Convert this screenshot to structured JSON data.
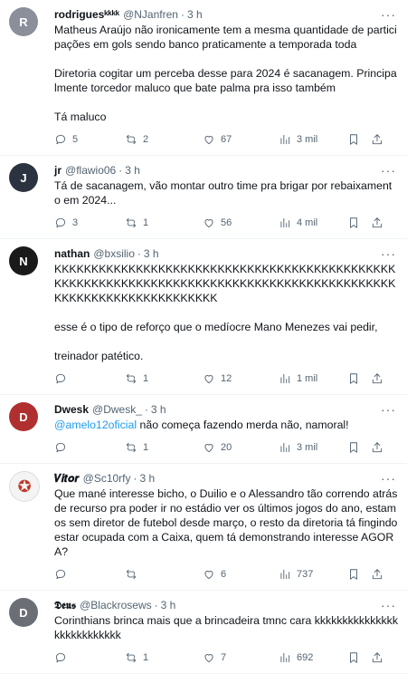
{
  "tweets": [
    {
      "name": "rodriguesᵏᵏᵏᵏ",
      "handle": "@NJanfren",
      "time": "3 h",
      "avatar_color": "#8a8f99",
      "avatar_initial": "R",
      "paragraphs": [
        "Matheus Araújo não ironicamente tem a mesma quantidade de participações em gols sendo banco praticamente a temporada toda",
        "Diretoria cogitar um perceba desse para 2024 é sacanagem. Principalmente torcedor maluco que bate palma pra isso também",
        "Tá maluco"
      ],
      "replies": "5",
      "retweets": "2",
      "likes": "67",
      "views": "3 mil"
    },
    {
      "name": "jr",
      "handle": "@flawio06",
      "time": "3 h",
      "avatar_color": "#2b3340",
      "avatar_initial": "J",
      "paragraphs": [
        "Tá de sacanagem, vão montar outro time pra brigar por rebaixamento em 2024..."
      ],
      "replies": "3",
      "retweets": "1",
      "likes": "56",
      "views": "4 mil"
    },
    {
      "name": "nathan",
      "handle": "@bxsilio",
      "time": "3 h",
      "avatar_color": "#1a1a1a",
      "avatar_initial": "N",
      "paragraphs": [
        "KKKKKKKKKKKKKKKKKKKKKKKKKKKKKKKKKKKKKKKKKKKKKKKKKKKKKKKKKKKKKKKKKKKKKKKKKKKKKKKKKKKKKKKKKKKKKKKKKKKKKKKKKKKKKKKKKK",
        "esse é o tipo de reforço que o medíocre Mano Menezes vai pedir,",
        "treinador patético."
      ],
      "replies": "",
      "retweets": "1",
      "likes": "12",
      "views": "1 mil"
    },
    {
      "name": "Dwesk",
      "handle": "@Dwesk_",
      "time": "3 h",
      "avatar_color": "#b03030",
      "avatar_initial": "D",
      "mention": "@amelo12oficial",
      "paragraphs": [
        " não começa fazendo merda não, namoral!"
      ],
      "replies": "",
      "retweets": "1",
      "likes": "20",
      "views": "3 mil"
    },
    {
      "name": "𝑽𝒊𝒕𝒐𝒓",
      "handle": "@Sc10rfy",
      "time": "3 h",
      "avatar_color": "#f4f4f4",
      "avatar_initial": "✪",
      "paragraphs": [
        "Que mané interesse bicho, o Duilio e o Alessandro tão correndo atrás de recurso pra poder ir no estádio ver os últimos jogos do ano, estamos sem diretor de futebol desde março, o resto da diretoria tá fingindo estar ocupada com a Caixa, quem tá demonstrando interesse AGORA?"
      ],
      "replies": "",
      "retweets": "",
      "likes": "6",
      "views": "737"
    },
    {
      "name": "𝕯𝖊𝖚𝖘",
      "handle": "@Blackrosews",
      "time": "3 h",
      "avatar_color": "#6b6f75",
      "avatar_initial": "D",
      "paragraphs": [
        "Corinthians brinca mais que a brincadeira tmnc cara kkkkkkkkkkkkkkkkkkkkkkkkkkk"
      ],
      "replies": "",
      "retweets": "1",
      "likes": "7",
      "views": "692"
    }
  ],
  "icons": {
    "reply": "reply-icon",
    "retweet": "retweet-icon",
    "like": "heart-icon",
    "views": "views-icon",
    "bookmark": "bookmark-icon",
    "share": "share-icon",
    "more": "more-icon"
  },
  "more_glyph": "···"
}
